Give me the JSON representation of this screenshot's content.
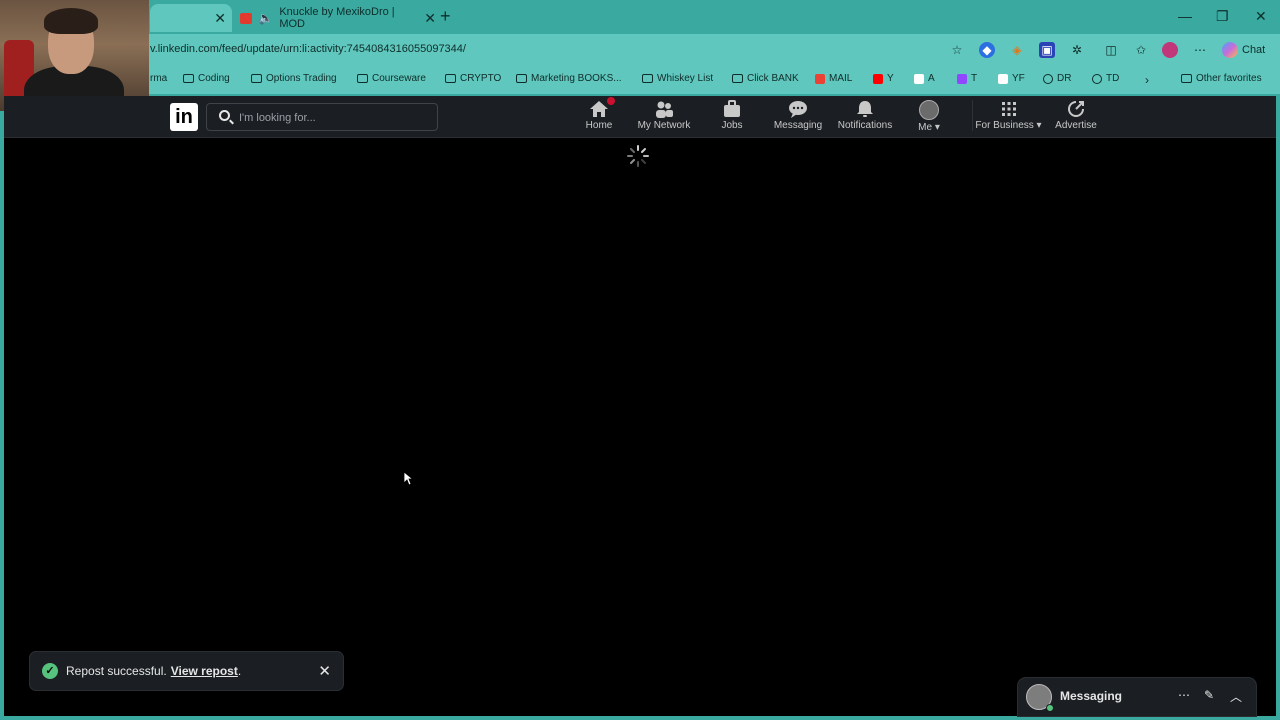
{
  "browser": {
    "tabs": [
      {
        "title": "",
        "active": true
      },
      {
        "title": "Knuckle by MexikoDro | MOD",
        "active": false,
        "audio": true
      }
    ],
    "url": "v.linkedin.com/feed/update/urn:li:activity:7454084316055097344/",
    "chat_label": "Chat",
    "bookmarks": [
      {
        "label": "rma",
        "type": "text"
      },
      {
        "label": "Coding",
        "type": "folder"
      },
      {
        "label": "Options Trading",
        "type": "folder"
      },
      {
        "label": "Courseware",
        "type": "folder"
      },
      {
        "label": "CRYPTO",
        "type": "folder"
      },
      {
        "label": "Marketing BOOKS...",
        "type": "folder"
      },
      {
        "label": "Whiskey List",
        "type": "folder"
      },
      {
        "label": "Click BANK",
        "type": "folder"
      },
      {
        "label": "MAIL",
        "type": "gmail"
      },
      {
        "label": "Y",
        "type": "youtube"
      },
      {
        "label": "A",
        "type": "amazon"
      },
      {
        "label": "T",
        "type": "twitch"
      },
      {
        "label": "YF",
        "type": "site"
      },
      {
        "label": "DR",
        "type": "globe"
      },
      {
        "label": "TD",
        "type": "globe"
      },
      {
        "label": "Other favorites",
        "type": "folder"
      }
    ]
  },
  "linkedin": {
    "logo_text": "in",
    "search_placeholder": "I'm looking for...",
    "nav": {
      "home": "Home",
      "network": "My Network",
      "jobs": "Jobs",
      "messaging": "Messaging",
      "notifications": "Notifications",
      "me": "Me",
      "business": "For Business",
      "advertise": "Advertise"
    },
    "toast": {
      "message": "Repost successful.",
      "link": "View repost",
      "suffix": "."
    },
    "messaging_bar": {
      "title": "Messaging"
    }
  },
  "colors": {
    "chrome": "#3aa9a0",
    "chrome_light": "#5fc7bd",
    "ln_nav": "#1b1f23",
    "success": "#57c27d",
    "badge": "#cb112d"
  }
}
